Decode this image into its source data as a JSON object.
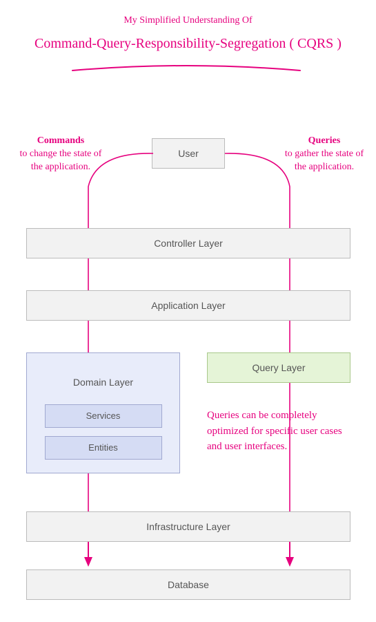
{
  "header": {
    "subtitle": "My Simplified Understanding Of",
    "title": "Command-Query-Responsibility-Segregation ( CQRS )"
  },
  "annotations": {
    "commands_heading": "Commands",
    "commands_body": "to change the state of the application.",
    "queries_heading": "Queries",
    "queries_body": "to gather the state of the application.",
    "query_note": "Queries can be completely optimized for specific user cases and user interfaces."
  },
  "boxes": {
    "user": "User",
    "controller": "Controller Layer",
    "application": "Application Layer",
    "domain": "Domain Layer",
    "services": "Services",
    "entities": "Entities",
    "query": "Query Layer",
    "infrastructure": "Infrastructure Layer",
    "database": "Database"
  },
  "chart_data": {
    "type": "diagram",
    "title": "Command-Query-Responsibility-Segregation ( CQRS )",
    "nodes": [
      {
        "id": "user",
        "label": "User"
      },
      {
        "id": "controller",
        "label": "Controller Layer"
      },
      {
        "id": "application",
        "label": "Application Layer"
      },
      {
        "id": "domain",
        "label": "Domain Layer",
        "children": [
          "services",
          "entities"
        ]
      },
      {
        "id": "services",
        "label": "Services"
      },
      {
        "id": "entities",
        "label": "Entities"
      },
      {
        "id": "query",
        "label": "Query Layer"
      },
      {
        "id": "infrastructure",
        "label": "Infrastructure Layer"
      },
      {
        "id": "database",
        "label": "Database"
      }
    ],
    "edges": [
      {
        "from": "user",
        "to": "controller",
        "path": "commands",
        "label": "Commands to change the state of the application."
      },
      {
        "from": "user",
        "to": "controller",
        "path": "queries",
        "label": "Queries to gather the state of the application."
      },
      {
        "from": "controller",
        "to": "application",
        "path": "commands"
      },
      {
        "from": "controller",
        "to": "application",
        "path": "queries"
      },
      {
        "from": "application",
        "to": "domain",
        "path": "commands"
      },
      {
        "from": "application",
        "to": "query",
        "path": "queries"
      },
      {
        "from": "domain",
        "to": "infrastructure",
        "path": "commands"
      },
      {
        "from": "query",
        "to": "infrastructure",
        "path": "queries",
        "note": "Queries can be completely optimized for specific user cases and user interfaces."
      },
      {
        "from": "infrastructure",
        "to": "database",
        "path": "commands",
        "arrow": true
      },
      {
        "from": "infrastructure",
        "to": "database",
        "path": "queries",
        "arrow": true
      }
    ]
  }
}
